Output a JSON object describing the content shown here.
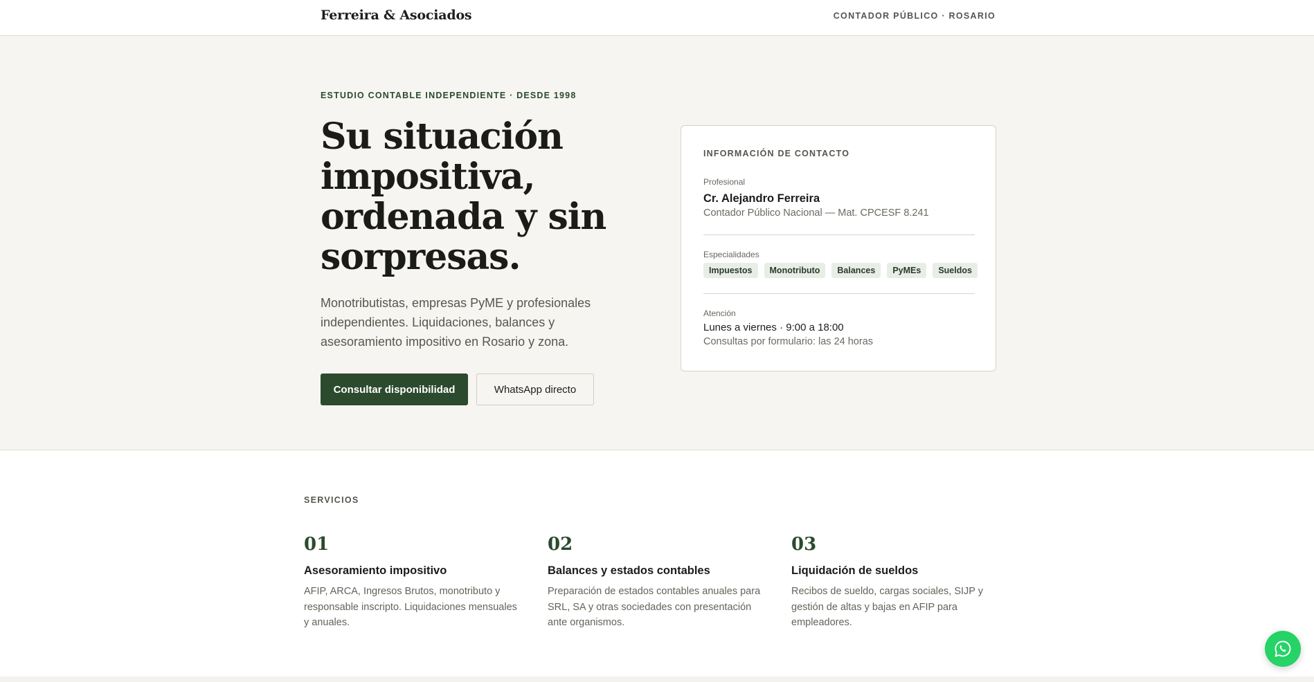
{
  "header": {
    "brand": "Ferreira & Asociados",
    "tagline": "CONTADOR PÚBLICO · ROSARIO"
  },
  "hero": {
    "eyebrow": "ESTUDIO CONTABLE INDEPENDIENTE · DESDE 1998",
    "headline": "Su situación impositiva, ordenada y sin sorpresas.",
    "lead": "Monotributistas, empresas PyME y profesionales independientes. Liquidaciones, balances y asesoramiento impositivo en Rosario y zona.",
    "primary_button": "Consultar disponibilidad",
    "secondary_button": "WhatsApp directo"
  },
  "contact": {
    "title": "INFORMACIÓN DE CONTACTO",
    "professional_label": "Profesional",
    "name": "Cr. Alejandro Ferreira",
    "subtitle": "Contador Público Nacional — Mat. CPCESF 8.241",
    "specialties_label": "Especialidades",
    "specialties": [
      "Impuestos",
      "Monotributo",
      "Balances",
      "PyMEs",
      "Sueldos"
    ],
    "hours_label": "Atención",
    "hours": "Lunes a viernes · 9:00 a 18:00",
    "hours_note": "Consultas por formulario: las 24 horas"
  },
  "services": {
    "label": "SERVICIOS",
    "items": [
      {
        "num": "01",
        "title": "Asesoramiento impositivo",
        "desc": "AFIP, ARCA, Ingresos Brutos, monotributo y responsable inscripto. Liquidaciones mensuales y anuales."
      },
      {
        "num": "02",
        "title": "Balances y estados contables",
        "desc": "Preparación de estados contables anuales para SRL, SA y otras sociedades con presentación ante organismos."
      },
      {
        "num": "03",
        "title": "Liquidación de sueldos",
        "desc": "Recibos de sueldo, cargas sociales, SIJP y gestión de altas y bajas en AFIP para empleadores."
      }
    ]
  },
  "icons": {
    "whatsapp": "whatsapp-icon"
  },
  "colors": {
    "accent": "#2c4a2e",
    "hero_bg": "#f6f5f1",
    "whatsapp": "#25d366"
  }
}
